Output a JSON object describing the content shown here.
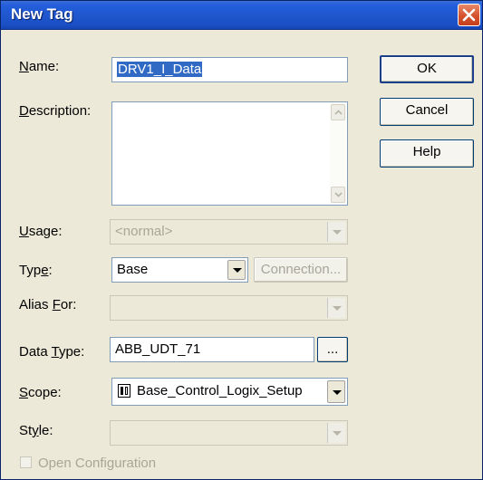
{
  "window": {
    "title": "New Tag"
  },
  "labels": {
    "name": "Name:",
    "description": "Description:",
    "usage": "Usage:",
    "type": "Type:",
    "alias_for": "Alias For:",
    "data_type": "Data Type:",
    "scope": "Scope:",
    "style": "Style:"
  },
  "fields": {
    "name_value": "DRV1_I_Data",
    "description_value": "",
    "usage_value": "<normal>",
    "type_value": "Base",
    "alias_for_value": "",
    "data_type_value": "ABB_UDT_71",
    "scope_value": "Base_Control_Logix_Setup",
    "style_value": ""
  },
  "buttons": {
    "ok": "OK",
    "cancel": "Cancel",
    "help": "Help",
    "connection": "Connection...",
    "browse": "..."
  },
  "checkbox": {
    "open_configuration": "Open Configuration",
    "checked": false
  },
  "icons": {
    "close": "close-icon",
    "scope": "controller-icon"
  },
  "colors": {
    "titlebar": "#245edb",
    "dialog_bg": "#ece9d8",
    "selection": "#316ac5",
    "close_button": "#d6522e"
  }
}
